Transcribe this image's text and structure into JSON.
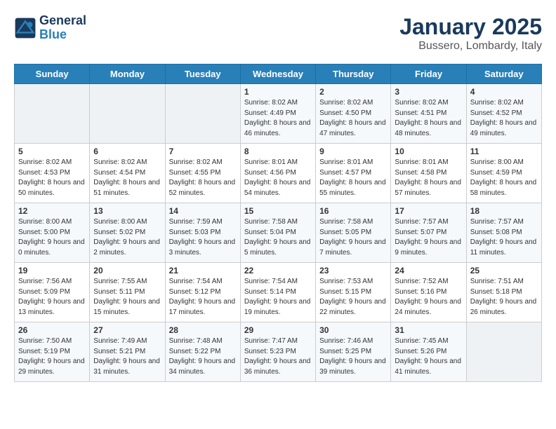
{
  "logo": {
    "line1": "General",
    "line2": "Blue"
  },
  "title": "January 2025",
  "location": "Bussero, Lombardy, Italy",
  "days_header": [
    "Sunday",
    "Monday",
    "Tuesday",
    "Wednesday",
    "Thursday",
    "Friday",
    "Saturday"
  ],
  "weeks": [
    [
      {
        "day": "",
        "info": ""
      },
      {
        "day": "",
        "info": ""
      },
      {
        "day": "",
        "info": ""
      },
      {
        "day": "1",
        "info": "Sunrise: 8:02 AM\nSunset: 4:49 PM\nDaylight: 8 hours and 46 minutes."
      },
      {
        "day": "2",
        "info": "Sunrise: 8:02 AM\nSunset: 4:50 PM\nDaylight: 8 hours and 47 minutes."
      },
      {
        "day": "3",
        "info": "Sunrise: 8:02 AM\nSunset: 4:51 PM\nDaylight: 8 hours and 48 minutes."
      },
      {
        "day": "4",
        "info": "Sunrise: 8:02 AM\nSunset: 4:52 PM\nDaylight: 8 hours and 49 minutes."
      }
    ],
    [
      {
        "day": "5",
        "info": "Sunrise: 8:02 AM\nSunset: 4:53 PM\nDaylight: 8 hours and 50 minutes."
      },
      {
        "day": "6",
        "info": "Sunrise: 8:02 AM\nSunset: 4:54 PM\nDaylight: 8 hours and 51 minutes."
      },
      {
        "day": "7",
        "info": "Sunrise: 8:02 AM\nSunset: 4:55 PM\nDaylight: 8 hours and 52 minutes."
      },
      {
        "day": "8",
        "info": "Sunrise: 8:01 AM\nSunset: 4:56 PM\nDaylight: 8 hours and 54 minutes."
      },
      {
        "day": "9",
        "info": "Sunrise: 8:01 AM\nSunset: 4:57 PM\nDaylight: 8 hours and 55 minutes."
      },
      {
        "day": "10",
        "info": "Sunrise: 8:01 AM\nSunset: 4:58 PM\nDaylight: 8 hours and 57 minutes."
      },
      {
        "day": "11",
        "info": "Sunrise: 8:00 AM\nSunset: 4:59 PM\nDaylight: 8 hours and 58 minutes."
      }
    ],
    [
      {
        "day": "12",
        "info": "Sunrise: 8:00 AM\nSunset: 5:00 PM\nDaylight: 9 hours and 0 minutes."
      },
      {
        "day": "13",
        "info": "Sunrise: 8:00 AM\nSunset: 5:02 PM\nDaylight: 9 hours and 2 minutes."
      },
      {
        "day": "14",
        "info": "Sunrise: 7:59 AM\nSunset: 5:03 PM\nDaylight: 9 hours and 3 minutes."
      },
      {
        "day": "15",
        "info": "Sunrise: 7:58 AM\nSunset: 5:04 PM\nDaylight: 9 hours and 5 minutes."
      },
      {
        "day": "16",
        "info": "Sunrise: 7:58 AM\nSunset: 5:05 PM\nDaylight: 9 hours and 7 minutes."
      },
      {
        "day": "17",
        "info": "Sunrise: 7:57 AM\nSunset: 5:07 PM\nDaylight: 9 hours and 9 minutes."
      },
      {
        "day": "18",
        "info": "Sunrise: 7:57 AM\nSunset: 5:08 PM\nDaylight: 9 hours and 11 minutes."
      }
    ],
    [
      {
        "day": "19",
        "info": "Sunrise: 7:56 AM\nSunset: 5:09 PM\nDaylight: 9 hours and 13 minutes."
      },
      {
        "day": "20",
        "info": "Sunrise: 7:55 AM\nSunset: 5:11 PM\nDaylight: 9 hours and 15 minutes."
      },
      {
        "day": "21",
        "info": "Sunrise: 7:54 AM\nSunset: 5:12 PM\nDaylight: 9 hours and 17 minutes."
      },
      {
        "day": "22",
        "info": "Sunrise: 7:54 AM\nSunset: 5:14 PM\nDaylight: 9 hours and 19 minutes."
      },
      {
        "day": "23",
        "info": "Sunrise: 7:53 AM\nSunset: 5:15 PM\nDaylight: 9 hours and 22 minutes."
      },
      {
        "day": "24",
        "info": "Sunrise: 7:52 AM\nSunset: 5:16 PM\nDaylight: 9 hours and 24 minutes."
      },
      {
        "day": "25",
        "info": "Sunrise: 7:51 AM\nSunset: 5:18 PM\nDaylight: 9 hours and 26 minutes."
      }
    ],
    [
      {
        "day": "26",
        "info": "Sunrise: 7:50 AM\nSunset: 5:19 PM\nDaylight: 9 hours and 29 minutes."
      },
      {
        "day": "27",
        "info": "Sunrise: 7:49 AM\nSunset: 5:21 PM\nDaylight: 9 hours and 31 minutes."
      },
      {
        "day": "28",
        "info": "Sunrise: 7:48 AM\nSunset: 5:22 PM\nDaylight: 9 hours and 34 minutes."
      },
      {
        "day": "29",
        "info": "Sunrise: 7:47 AM\nSunset: 5:23 PM\nDaylight: 9 hours and 36 minutes."
      },
      {
        "day": "30",
        "info": "Sunrise: 7:46 AM\nSunset: 5:25 PM\nDaylight: 9 hours and 39 minutes."
      },
      {
        "day": "31",
        "info": "Sunrise: 7:45 AM\nSunset: 5:26 PM\nDaylight: 9 hours and 41 minutes."
      },
      {
        "day": "",
        "info": ""
      }
    ]
  ]
}
